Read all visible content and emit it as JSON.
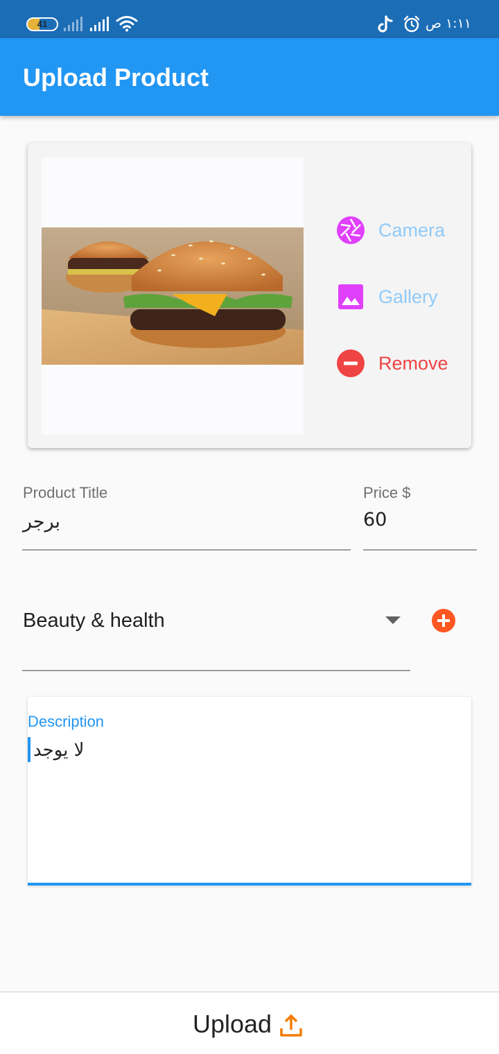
{
  "status_bar": {
    "battery": "41",
    "battery_level": 0.41,
    "time": "١:١١ ص",
    "icons": [
      "battery-icon",
      "signal-icon",
      "signal-icon",
      "wifi-icon",
      "tiktok-icon",
      "alarm-icon"
    ]
  },
  "app_bar": {
    "title": "Upload Product"
  },
  "image_picker": {
    "camera_label": "Camera",
    "gallery_label": "Gallery",
    "remove_label": "Remove"
  },
  "form": {
    "title_label": "Product Title",
    "title_value": "برجر",
    "price_label": "Price $",
    "price_value": "60",
    "category_value": "Beauty & health",
    "description_label": "Description",
    "description_value": "لا يوجد"
  },
  "bottom": {
    "upload_label": "Upload"
  },
  "colors": {
    "app_bar": "#2196f3",
    "status_bar": "#1b6db6",
    "icon_magenta": "#e040fb",
    "remove_red": "#ef4444",
    "add_orange": "#ff5722",
    "upload_orange": "#f57c00"
  }
}
